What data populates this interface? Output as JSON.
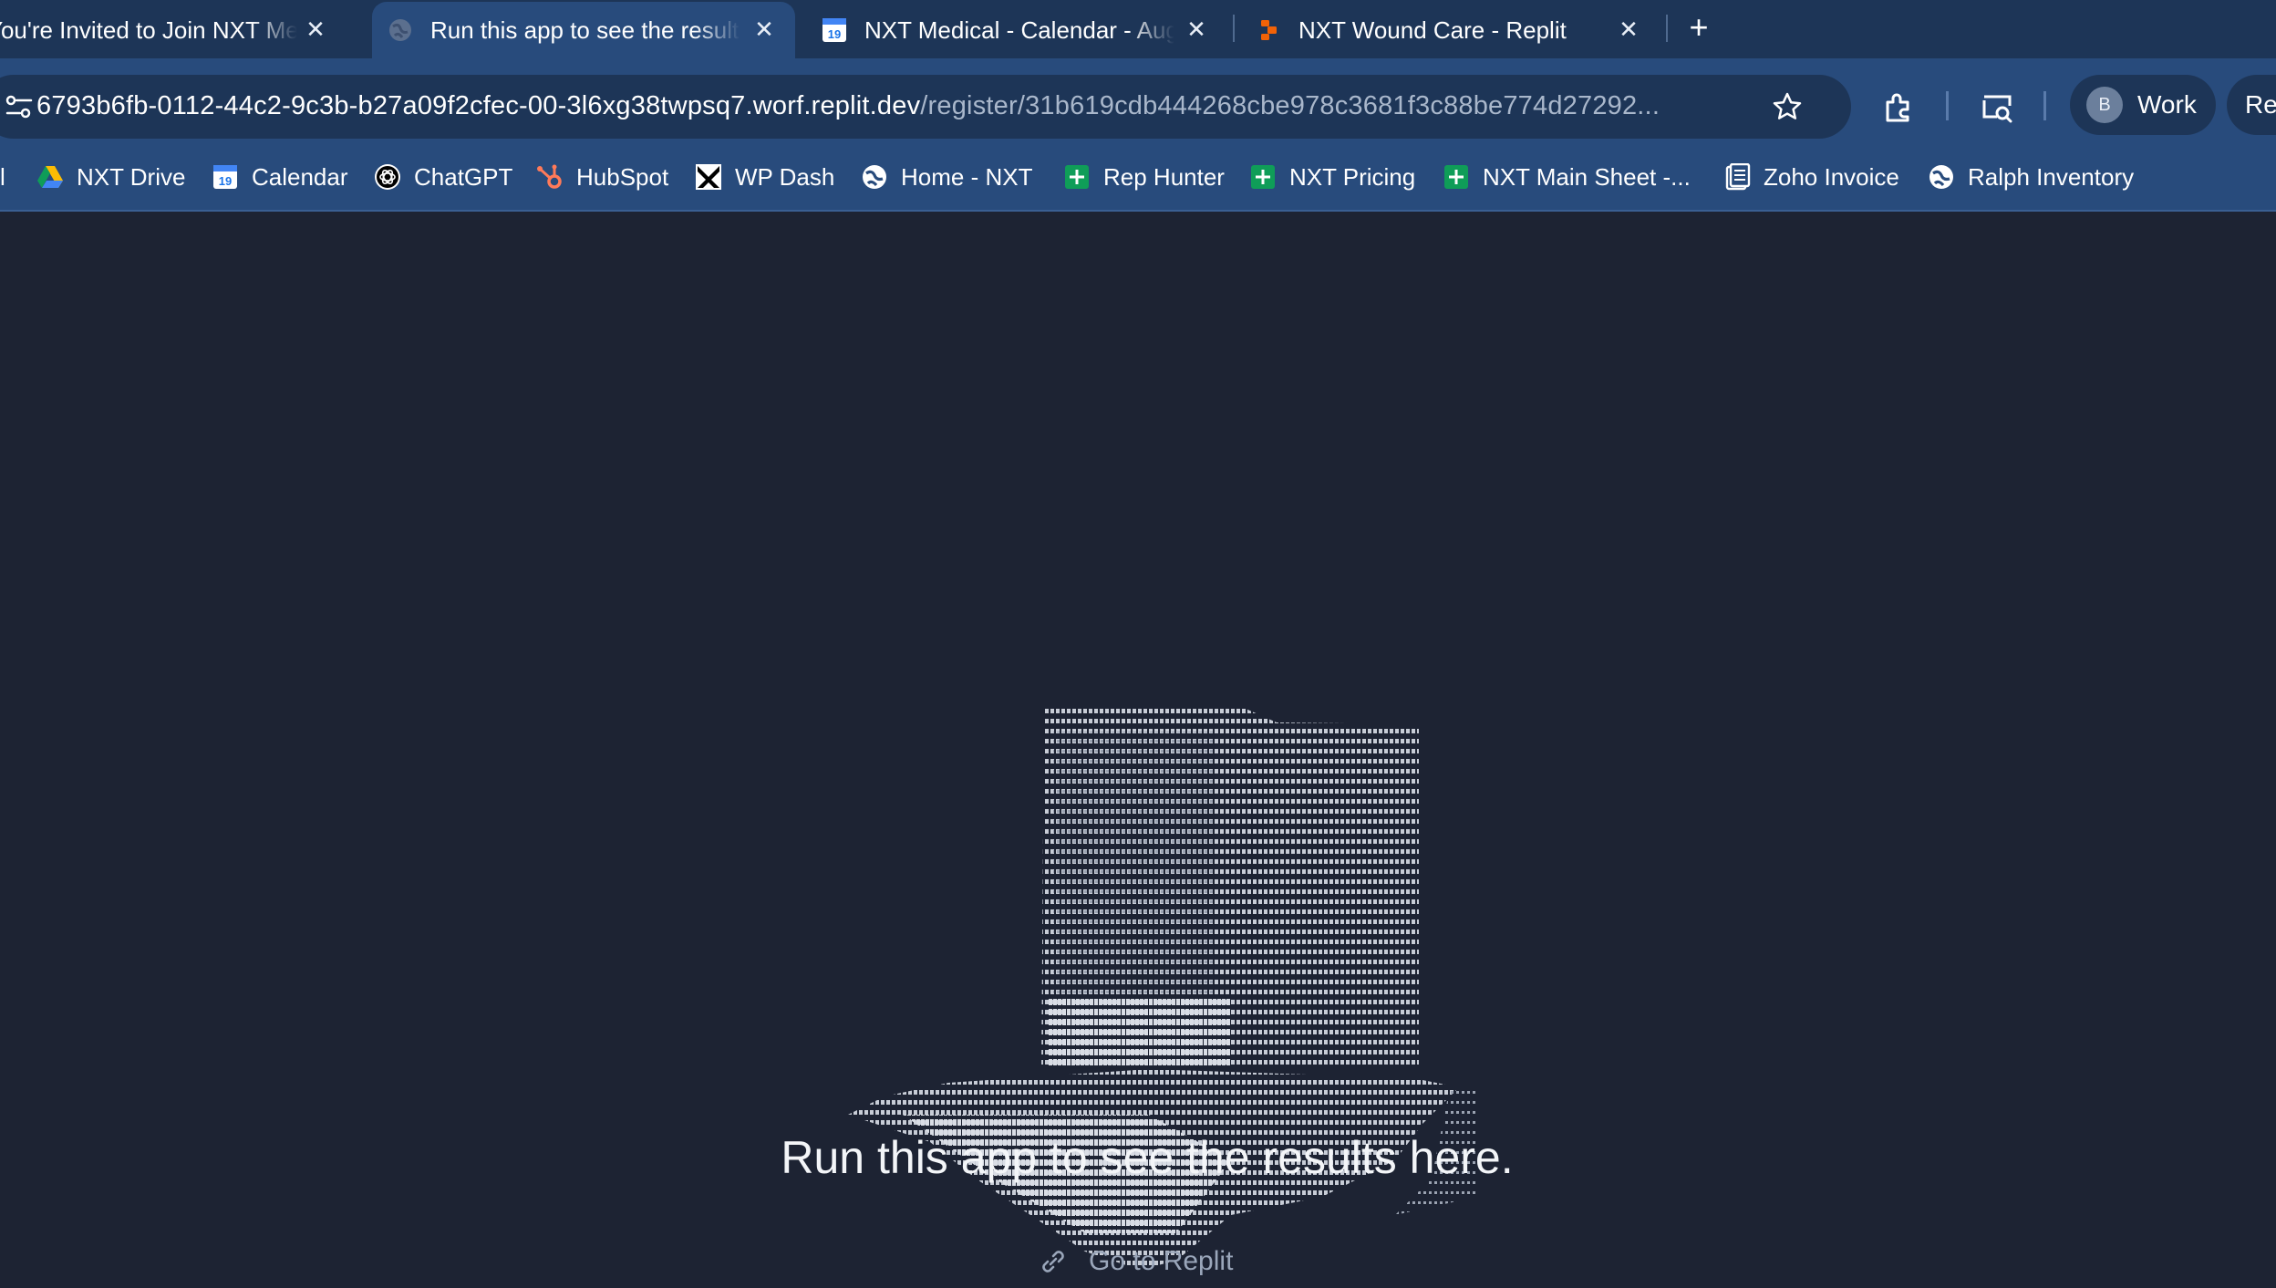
{
  "tabs": [
    {
      "title": "You're Invited to Join NXT Medical",
      "favicon": "mail-icon",
      "active": false
    },
    {
      "title": "Run this app to see the results here.",
      "favicon": "globe-icon",
      "active": true
    },
    {
      "title": "NXT Medical - Calendar - August",
      "favicon": "calendar-icon",
      "active": false
    },
    {
      "title": "NXT Wound Care - Replit",
      "favicon": "replit-icon",
      "active": false
    }
  ],
  "new_tab_label": "+",
  "close_glyph": "✕",
  "address_bar": {
    "host": "6793b6fb-0112-44c2-9c3b-b27a09f2cfec-00-3l6xg38twpsq7.worf.replit.dev",
    "path": "/register/31b619cdb444268cbe978c3681f3c88be774d27292..."
  },
  "profile": {
    "initial": "B",
    "label": "Work"
  },
  "relaunch_label": "Re",
  "bookmarks": [
    {
      "label": "l",
      "icon": "truncated"
    },
    {
      "label": "NXT Drive",
      "icon": "drive-icon"
    },
    {
      "label": "Calendar",
      "icon": "calendar-icon"
    },
    {
      "label": "ChatGPT",
      "icon": "chatgpt-icon"
    },
    {
      "label": "HubSpot",
      "icon": "hubspot-icon"
    },
    {
      "label": "WP Dash",
      "icon": "wp-dash-icon"
    },
    {
      "label": "Home - NXT",
      "icon": "globe-icon"
    },
    {
      "label": "Rep Hunter",
      "icon": "sheets-icon"
    },
    {
      "label": "NXT Pricing",
      "icon": "sheets-icon"
    },
    {
      "label": "NXT Main Sheet -...",
      "icon": "sheets-icon"
    },
    {
      "label": "Zoho Invoice",
      "icon": "invoice-icon"
    },
    {
      "label": "Ralph Inventory",
      "icon": "globe-icon"
    }
  ],
  "content": {
    "headline": "Run this app to see the results here.",
    "go_to_replit": "Go to Replit"
  },
  "colors": {
    "tabstrip": "#1d3557",
    "toolbar": "#284b7c",
    "content_bg": "#1d2333"
  }
}
